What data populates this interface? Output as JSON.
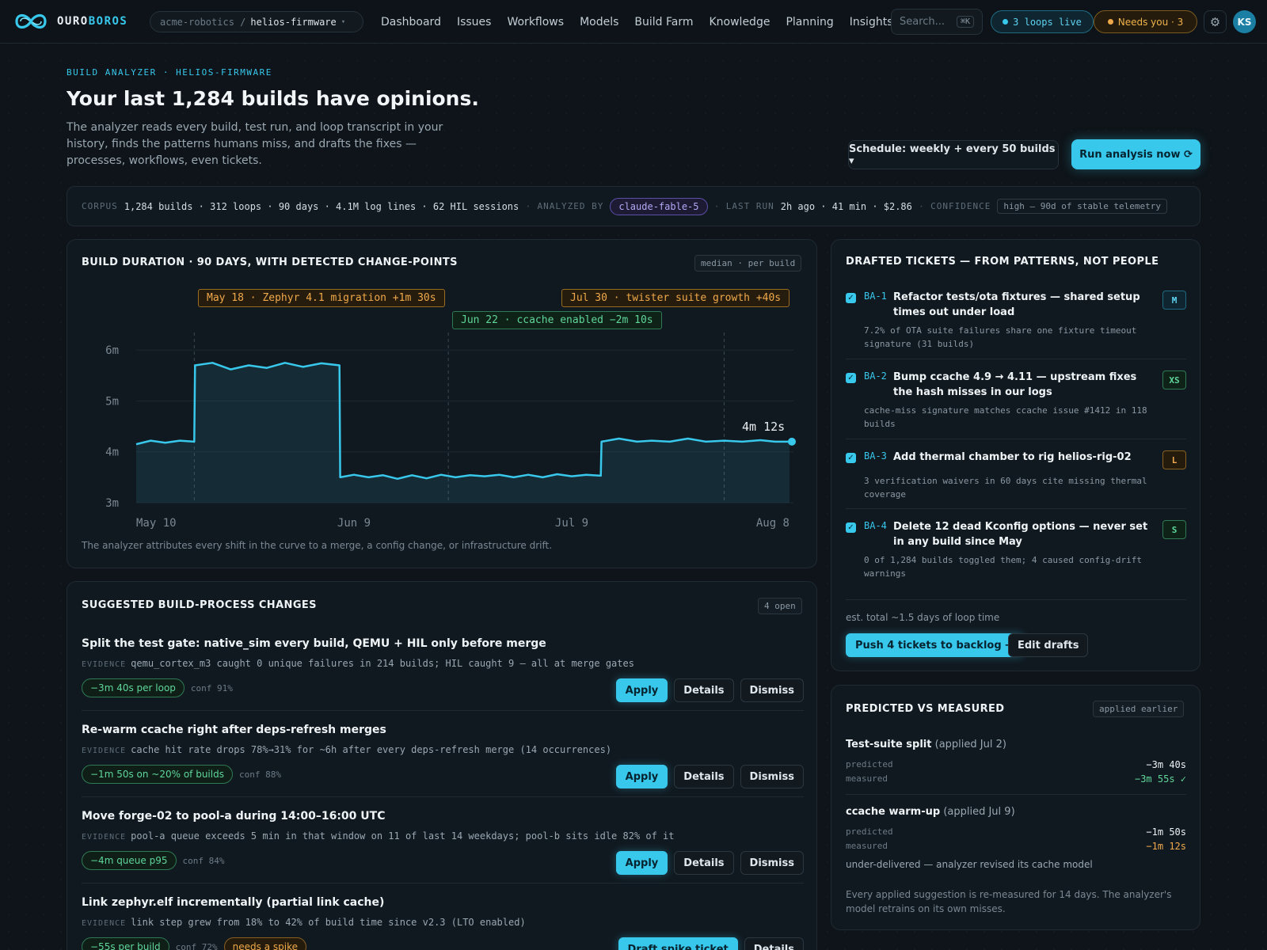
{
  "app": {
    "name_a": "OURO",
    "name_b": "BOROS"
  },
  "repo": {
    "org": "acme-robotics /",
    "name": "helios-firmware"
  },
  "nav": [
    "Dashboard",
    "Issues",
    "Workflows",
    "Models",
    "Build Farm",
    "Knowledge",
    "Planning",
    "Insights"
  ],
  "search": {
    "placeholder": "Search...",
    "shortcut": "⌘K"
  },
  "status": {
    "loops_live": "3 loops live",
    "needs_you": "Needs you · 3",
    "avatar_initials": "KS"
  },
  "colors": {
    "accent": "#38c8ec",
    "success": "#5fd69a",
    "warning": "#f0a94a",
    "model": "#b3a8f5"
  },
  "hero": {
    "eyebrow": "BUILD ANALYZER · HELIOS-FIRMWARE",
    "title": "Your last 1,284 builds have opinions.",
    "lede": "The analyzer reads every build, test run, and loop transcript in your history, finds the patterns humans miss, and drafts the fixes — processes, workflows, even tickets.",
    "schedule": "Schedule: weekly + every 50 builds ▾",
    "run": "Run analysis now ⟳"
  },
  "corpus": {
    "label": "CORPUS",
    "value": "1,284 builds · 312 loops · 90 days · 4.1M log lines · 62 HIL sessions",
    "analyzed_label": "ANALYZED BY",
    "model": "claude-fable-5",
    "last_run_label": "LAST RUN",
    "last_run": "2h ago · 41 min · $2.86",
    "confidence_label": "CONFIDENCE",
    "confidence": "high — 90d of stable telemetry"
  },
  "duration_panel": {
    "title": "BUILD DURATION · 90 DAYS, WITH DETECTED CHANGE-POINTS",
    "tag": "median · per build",
    "caption": "The analyzer attributes every shift in the curve to a merge, a config change, or infrastructure drift.",
    "current_label": "4m 12s"
  },
  "chart_data": {
    "type": "area",
    "title": "BUILD DURATION · 90 DAYS, WITH DETECTED CHANGE-POINTS",
    "xlabel": "",
    "ylabel": "",
    "unit": "minutes",
    "ylim": [
      3,
      6
    ],
    "y_ticks": [
      {
        "v": 6,
        "label": "6m"
      },
      {
        "v": 5,
        "label": "5m"
      },
      {
        "v": 4,
        "label": "4m"
      },
      {
        "v": 3,
        "label": "3m"
      }
    ],
    "x_ticks": [
      {
        "day": 0,
        "label": "May 10"
      },
      {
        "day": 30,
        "label": "Jun 9"
      },
      {
        "day": 60,
        "label": "Jul 9"
      },
      {
        "day": 90,
        "label": "Aug 8"
      }
    ],
    "xlim": [
      0,
      90
    ],
    "grid": true,
    "points": [
      [
        0,
        4.15
      ],
      [
        2,
        4.22
      ],
      [
        4,
        4.18
      ],
      [
        6,
        4.22
      ],
      [
        8,
        4.2
      ],
      [
        8.1,
        5.7
      ],
      [
        10.5,
        5.75
      ],
      [
        13,
        5.62
      ],
      [
        15.5,
        5.7
      ],
      [
        18,
        5.65
      ],
      [
        20.5,
        5.75
      ],
      [
        23,
        5.67
      ],
      [
        25.5,
        5.74
      ],
      [
        28,
        5.7
      ],
      [
        28.1,
        3.5
      ],
      [
        30,
        3.55
      ],
      [
        32,
        3.5
      ],
      [
        34,
        3.54
      ],
      [
        36,
        3.47
      ],
      [
        38,
        3.54
      ],
      [
        40,
        3.48
      ],
      [
        42,
        3.55
      ],
      [
        44,
        3.5
      ],
      [
        46,
        3.54
      ],
      [
        48,
        3.52
      ],
      [
        50,
        3.55
      ],
      [
        52,
        3.5
      ],
      [
        54,
        3.55
      ],
      [
        56,
        3.5
      ],
      [
        58,
        3.56
      ],
      [
        60,
        3.52
      ],
      [
        62,
        3.55
      ],
      [
        64,
        3.53
      ],
      [
        64.1,
        4.2
      ],
      [
        66.5,
        4.26
      ],
      [
        69,
        4.2
      ],
      [
        71,
        4.22
      ],
      [
        73.5,
        4.2
      ],
      [
        76,
        4.26
      ],
      [
        78.5,
        4.2
      ],
      [
        81,
        4.22
      ],
      [
        83.5,
        4.2
      ],
      [
        86,
        4.23
      ],
      [
        88,
        4.2
      ],
      [
        90,
        4.2
      ]
    ],
    "change_points": [
      {
        "day": 8,
        "label": "May 18 · Zephyr 4.1 migration +1m 30s",
        "kind": "regression"
      },
      {
        "day": 43,
        "label": "Jun 22 · ccache enabled −2m 10s",
        "kind": "improvement"
      },
      {
        "day": 81,
        "label": "Jul 30 · twister suite growth +40s",
        "kind": "regression"
      }
    ]
  },
  "suggestions": {
    "title": "SUGGESTED BUILD-PROCESS CHANGES",
    "tag": "4 open",
    "evidence_label": "EVIDENCE",
    "items": [
      {
        "title": "Split the test gate: native_sim every build, QEMU + HIL only before merge",
        "evidence": "qemu_cortex_m3 caught 0 unique failures in 214 builds; HIL caught 9 — all at merge gates",
        "gain": "−3m 40s per loop",
        "conf": "conf 91%",
        "primary": "Apply",
        "details": "Details",
        "dismiss": "Dismiss"
      },
      {
        "title": "Re-warm ccache right after deps-refresh merges",
        "evidence": "cache hit rate drops 78%→31% for ~6h after every deps-refresh merge (14 occurrences)",
        "gain": "−1m 50s on ~20% of builds",
        "conf": "conf 88%",
        "primary": "Apply",
        "details": "Details",
        "dismiss": "Dismiss"
      },
      {
        "title": "Move forge-02 to pool-a during 14:00–16:00 UTC",
        "evidence": "pool-a queue exceeds 5 min in that window on 11 of last 14 weekdays; pool-b sits idle 82% of it",
        "gain": "−4m queue p95",
        "conf": "conf 84%",
        "primary": "Apply",
        "details": "Details",
        "dismiss": "Dismiss"
      },
      {
        "title": "Link zephyr.elf incrementally (partial link cache)",
        "evidence": "link step grew from 18% to 42% of build time since v2.3 (LTO enabled)",
        "gain": "−55s per build",
        "conf": "conf 72%",
        "flag": "needs a spike",
        "primary": "Draft spike ticket",
        "details": "Details"
      }
    ]
  },
  "tickets": {
    "title": "DRAFTED TICKETS — FROM PATTERNS, NOT PEOPLE",
    "items": [
      {
        "id": "BA-1",
        "title": "Refactor tests/ota fixtures — shared setup times out under load",
        "desc": "7.2% of OTA suite failures share one fixture timeout signature (31 builds)",
        "size": "M",
        "color": "cyan"
      },
      {
        "id": "BA-2",
        "title": "Bump ccache 4.9 → 4.11 — upstream fixes the hash misses in our logs",
        "desc": "cache-miss signature matches ccache issue #1412 in 118 builds",
        "size": "XS",
        "color": "green"
      },
      {
        "id": "BA-3",
        "title": "Add thermal chamber to rig helios-rig-02",
        "desc": "3 verification waivers in 60 days cite missing thermal coverage",
        "size": "L",
        "color": "orange"
      },
      {
        "id": "BA-4",
        "title": "Delete 12 dead Kconfig options — never set in any build since May",
        "desc": "0 of 1,284 builds toggled them; 4 caused config-drift warnings",
        "size": "S",
        "color": "green"
      }
    ],
    "estimate": "est. total ~1.5 days of loop time",
    "push": "Push 4 tickets to backlog →",
    "edit": "Edit drafts"
  },
  "predicted": {
    "title": "PREDICTED VS MEASURED",
    "tag": "applied earlier",
    "items": [
      {
        "name": "Test-suite split",
        "applied": "(applied Jul 2)",
        "predicted_label": "predicted",
        "predicted": "−3m 40s",
        "measured_label": "measured",
        "measured": "−3m 55s ✓",
        "tone": "g"
      },
      {
        "name": "ccache warm-up",
        "applied": "(applied Jul 9)",
        "predicted_label": "predicted",
        "predicted": "−1m 50s",
        "measured_label": "measured",
        "measured": "−1m 12s",
        "tone": "o",
        "note": "under-delivered — analyzer revised its cache model"
      }
    ],
    "footer": "Every applied suggestion is re-measured for 14 days. The analyzer's model retrains on its own misses."
  }
}
